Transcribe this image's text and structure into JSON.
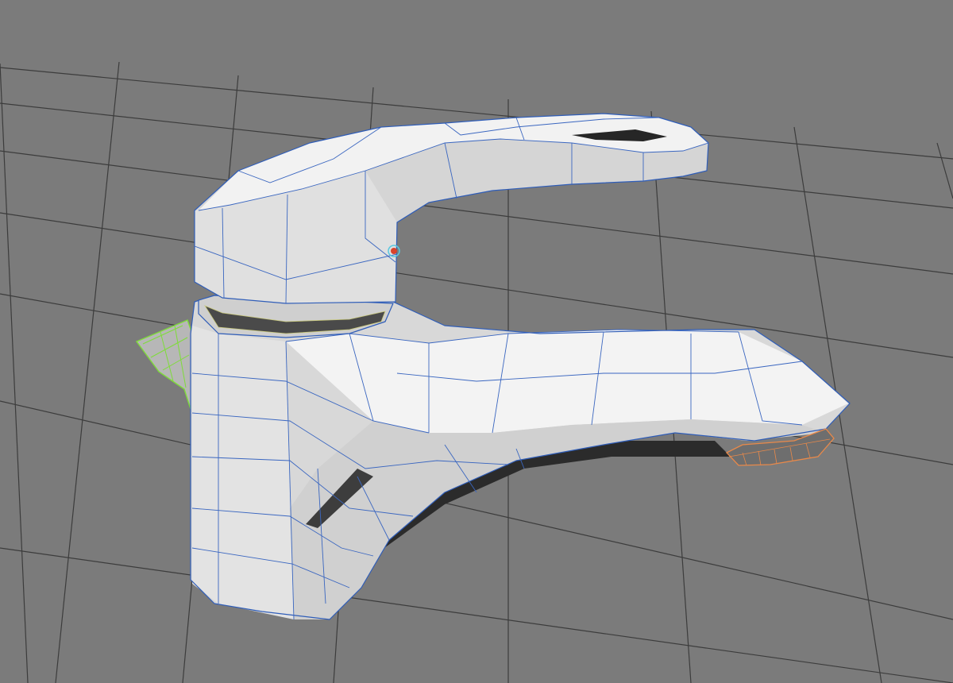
{
  "viewport": {
    "background_color": "#7b7b7b",
    "grid_color": "#3c3c3c",
    "model_fill_light": "#f2f2f2",
    "model_fill_mid": "#d9d9d9",
    "model_fill_shadow": "#b4b4b4",
    "wireframe_color": "#2f5db8",
    "selection_green": "#7fdc3a",
    "selection_orange": "#e8894a",
    "pivot_marker_color": "#d9432b"
  },
  "objects": [
    {
      "name": "faucet-body",
      "selected": false
    },
    {
      "name": "faucet-lever-handle",
      "selected": false
    },
    {
      "name": "faucet-spout",
      "selected": false
    },
    {
      "name": "side-pop-up-knob",
      "selected": true,
      "selection_color": "#7fdc3a"
    },
    {
      "name": "aerator-ring",
      "selected": true,
      "selection_color": "#e8894a"
    }
  ]
}
